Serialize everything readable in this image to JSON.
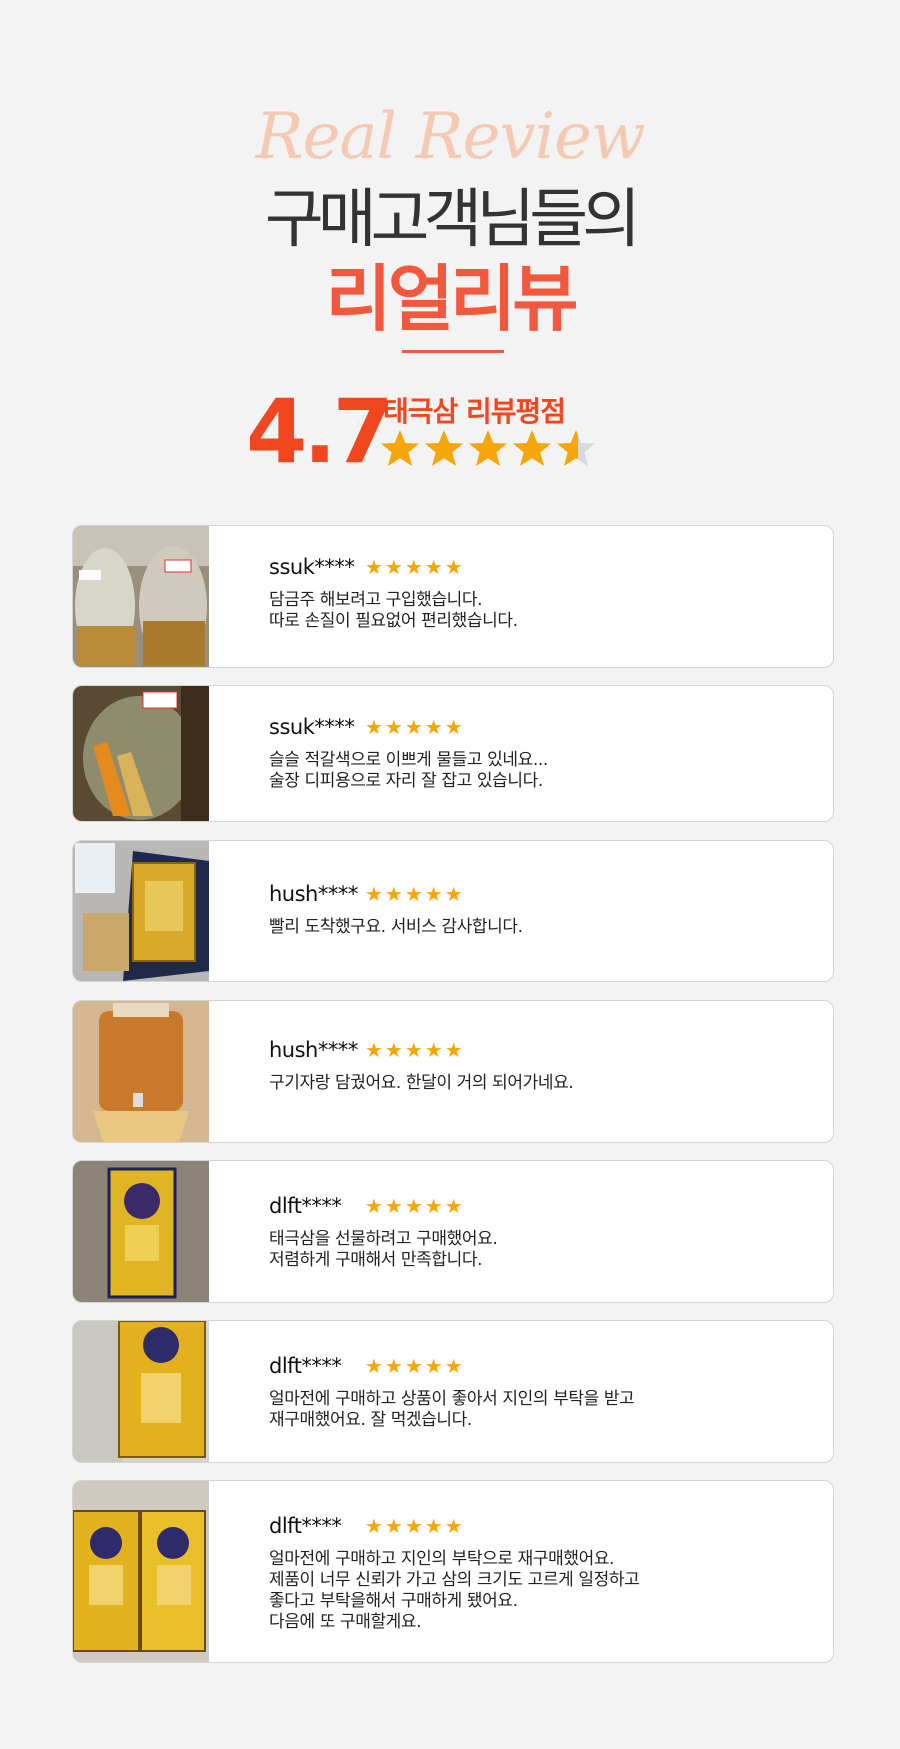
{
  "header": {
    "script_title": "Real Review",
    "headline": "구매고객님들의",
    "headline_accent": "리얼리뷰"
  },
  "rating": {
    "score": "4.7",
    "label": "태극삼 리뷰평점",
    "stars_value": 4.7,
    "stars_max": 5
  },
  "colors": {
    "accent": "#f2583e",
    "star": "#f5a60b",
    "background": "#f3f3f3"
  },
  "reviews": [
    {
      "user": "ssuk****",
      "stars": "★★★★★",
      "text": "담금주 해보려고 구입했습니다.\n따로 손질이 필요없어 편리했습니다.",
      "photo": "jars-photo"
    },
    {
      "user": "ssuk****",
      "stars": "★★★★★",
      "text": "슬슬 적갈색으로 이쁘게 물들고 있네요...\n술장 디피용으로 자리 잘 잡고 있습니다.",
      "photo": "jar-photo"
    },
    {
      "user": "hush****",
      "stars": "★★★★★",
      "text": "빨리 도착했구요. 서비스 감사합니다.",
      "photo": "package-photo"
    },
    {
      "user": "hush****",
      "stars": "★★★★★",
      "text": "구기자랑 담궜어요. 한달이 거의 되어가네요.",
      "photo": "dispenser-photo"
    },
    {
      "user": "dlft****",
      "stars": "★★★★★",
      "text": "태극삼을 선물하려고 구매했어요.\n저렴하게 구매해서 만족합니다.",
      "photo": "gold-box-photo"
    },
    {
      "user": "dlft****",
      "stars": "★★★★★",
      "text": "얼마전에 구매하고 상품이 좋아서 지인의 부탁을 받고\n재구매했어요. 잘 먹겠습니다.",
      "photo": "gold-box-wrapped-photo"
    },
    {
      "user": "dlft****",
      "stars": "★★★★★",
      "text": "얼마전에 구매하고 지인의 부탁으로 재구매했어요.\n제품이 너무 신뢰가 가고 삼의 크기도 고르게 일정하고\n좋다고 부탁을해서 구매하게 됐어요.\n다음에 또 구매할게요.",
      "photo": "two-boxes-photo"
    }
  ]
}
